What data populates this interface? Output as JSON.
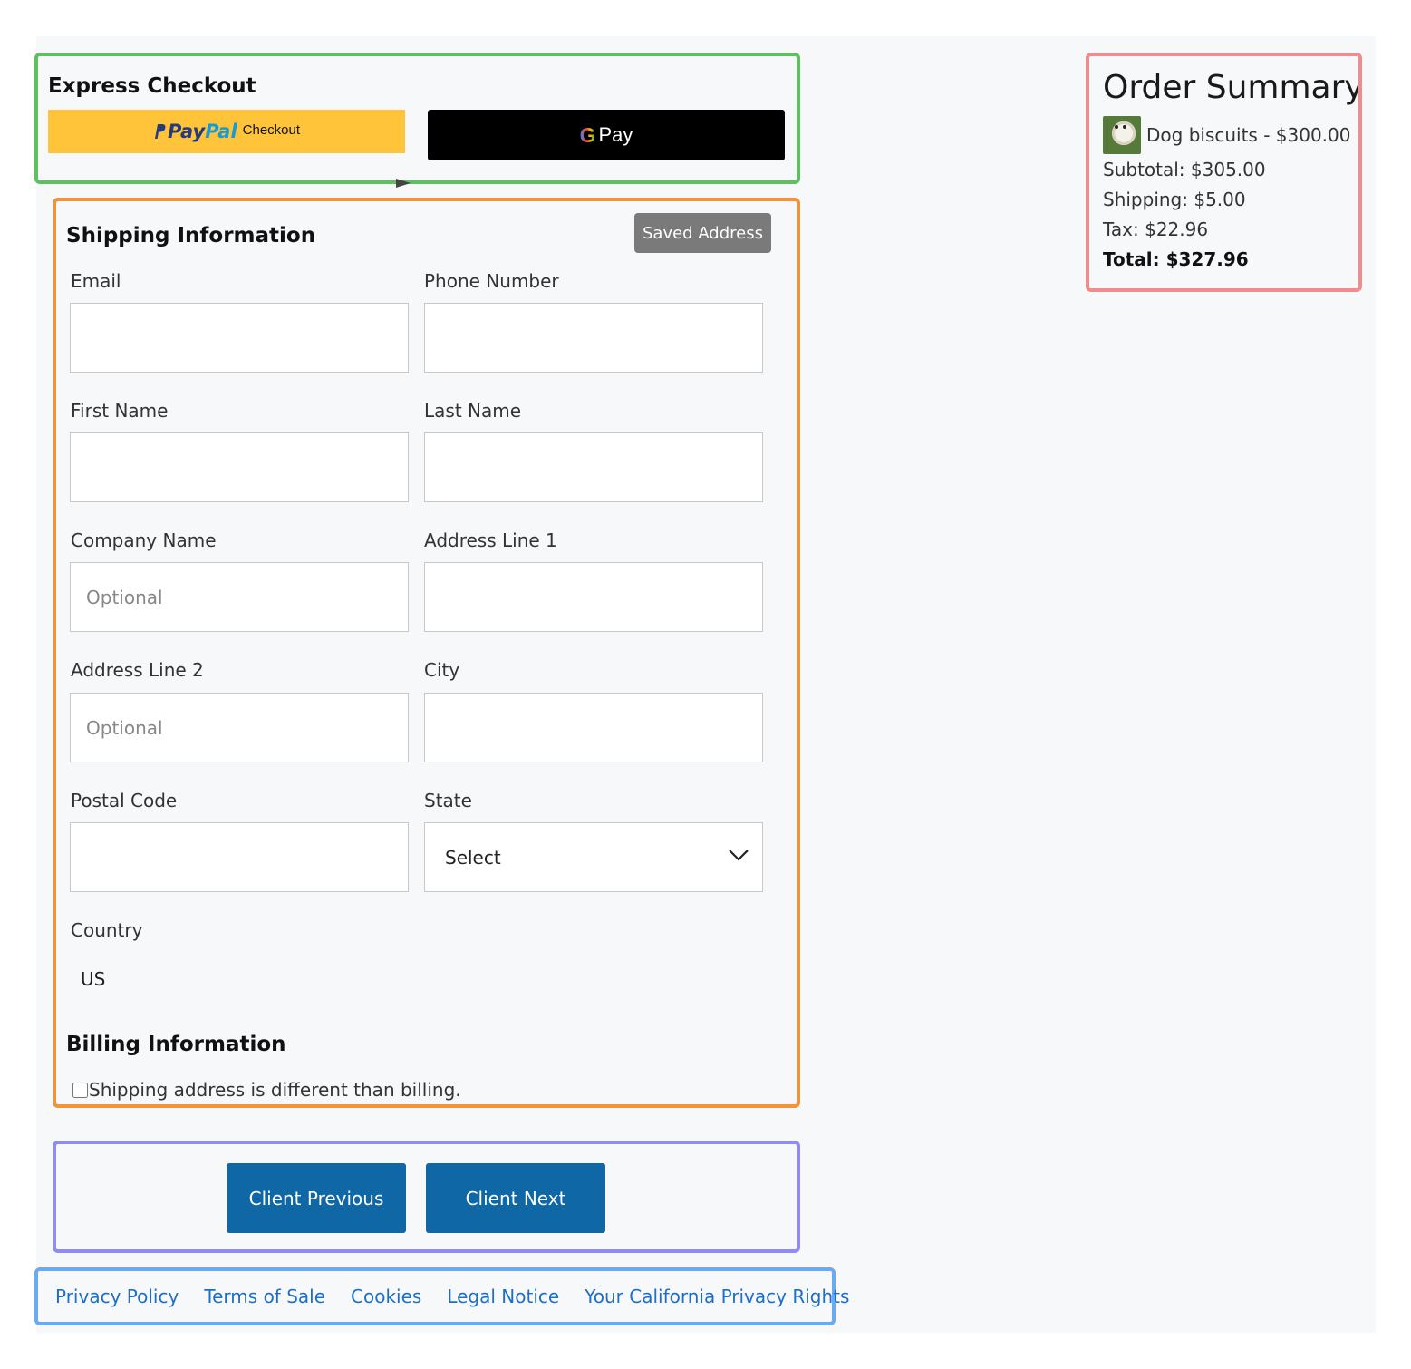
{
  "express_checkout": {
    "title": "Express Checkout",
    "paypal": {
      "brand_part1": "Pay",
      "brand_part2": "Pal",
      "label": "Checkout"
    },
    "gpay": {
      "g": "G",
      "label": "Pay"
    }
  },
  "shipping": {
    "title": "Shipping Information",
    "saved_address_label": "Saved Address",
    "fields": {
      "email": {
        "label": "Email",
        "value": "",
        "placeholder": ""
      },
      "phone": {
        "label": "Phone Number",
        "value": "",
        "placeholder": ""
      },
      "first_name": {
        "label": "First Name",
        "value": "",
        "placeholder": ""
      },
      "last_name": {
        "label": "Last Name",
        "value": "",
        "placeholder": ""
      },
      "company": {
        "label": "Company Name",
        "value": "",
        "placeholder": "Optional"
      },
      "address1": {
        "label": "Address Line 1",
        "value": "",
        "placeholder": ""
      },
      "address2": {
        "label": "Address Line 2",
        "value": "",
        "placeholder": "Optional"
      },
      "city": {
        "label": "City",
        "value": "",
        "placeholder": ""
      },
      "postal_code": {
        "label": "Postal Code",
        "value": "",
        "placeholder": ""
      },
      "state": {
        "label": "State",
        "selected": "Select"
      },
      "country": {
        "label": "Country",
        "value": "US"
      }
    }
  },
  "billing": {
    "title": "Billing Information",
    "different_address_label": "Shipping address is different than billing.",
    "checked": false
  },
  "navigation": {
    "previous_label": "Client Previous",
    "next_label": "Client Next"
  },
  "footer": {
    "links": [
      "Privacy Policy",
      "Terms of Sale",
      "Cookies",
      "Legal Notice",
      "Your California Privacy Rights"
    ]
  },
  "order_summary": {
    "title": "Order Summary",
    "item": "Dog biscuits - $300.00",
    "subtotal": "Subtotal: $305.00",
    "shipping": "Shipping: $5.00",
    "tax": "Tax: $22.96",
    "total": "Total: $327.96"
  },
  "colors": {
    "express_border": "#5cc15e",
    "shipping_border": "#f39237",
    "nav_border": "#918cf5",
    "footer_border": "#6aaaf0",
    "summary_border": "#f28b8b",
    "primary_button": "#0f67a6",
    "paypal_yellow": "#ffc439"
  }
}
